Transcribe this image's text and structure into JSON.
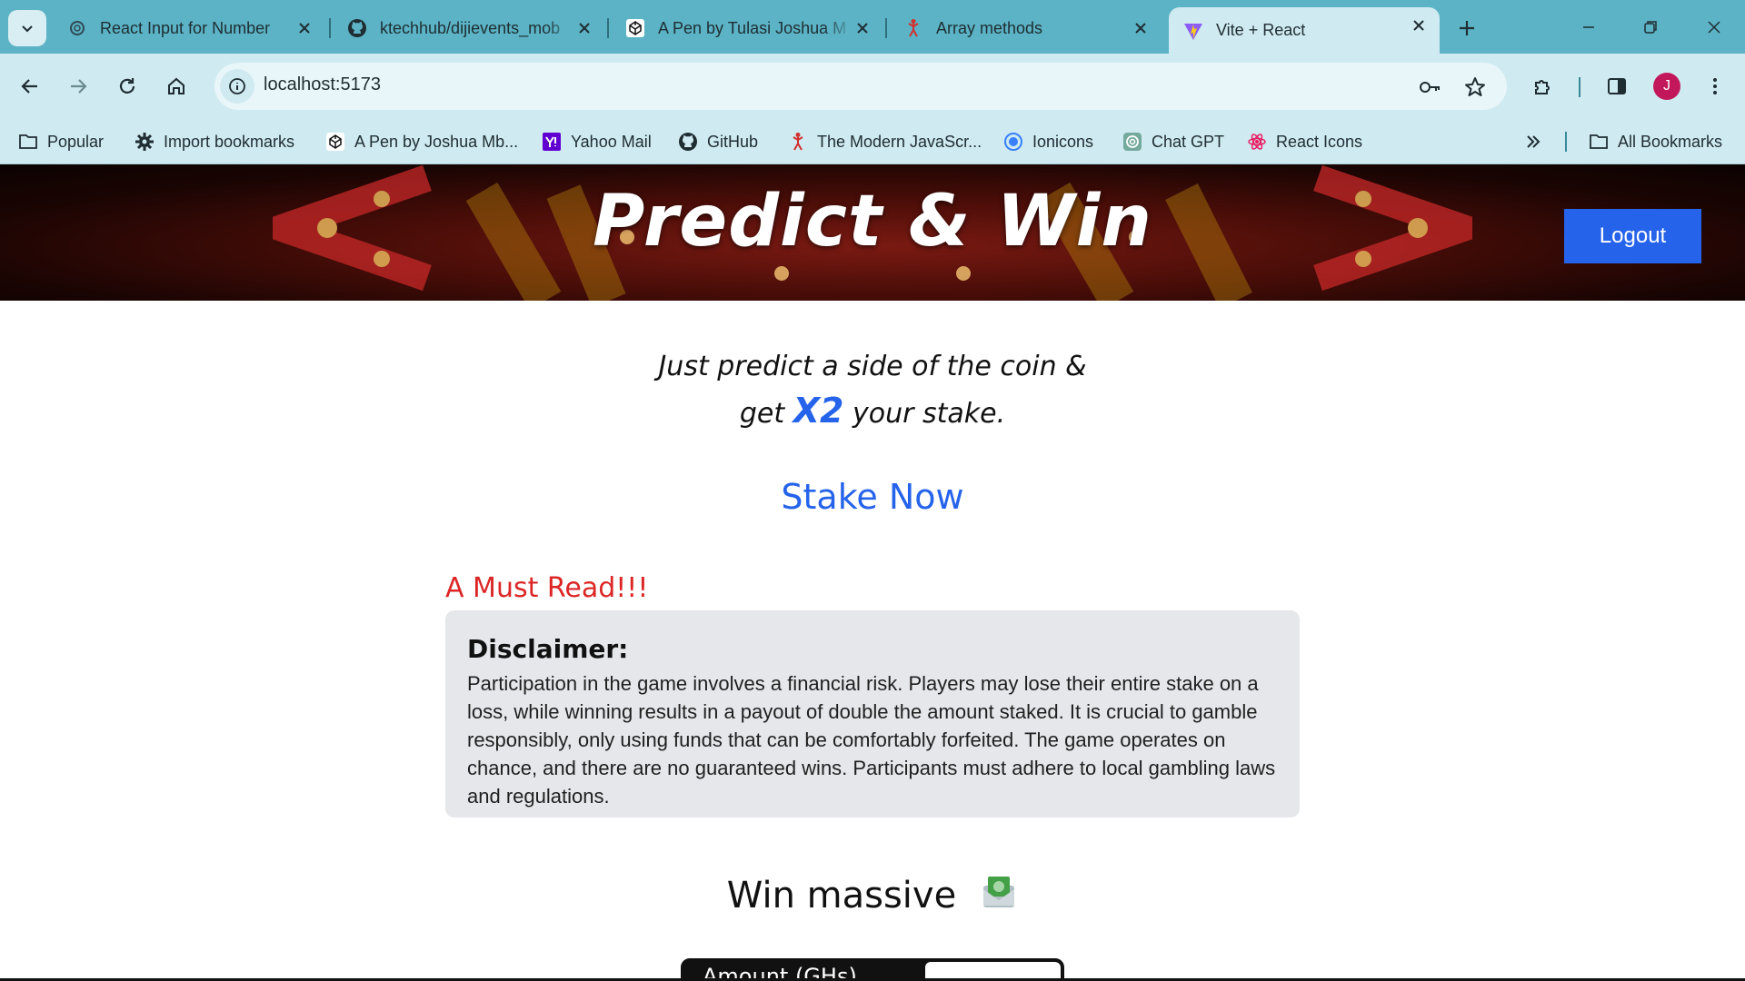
{
  "tabs": [
    {
      "title": "React Input for Number",
      "icon": "openai-icon"
    },
    {
      "title": "ktechhub/dijievents_mob",
      "icon": "github-icon"
    },
    {
      "title": "A Pen by Tulasi Joshua M",
      "icon": "codepen-icon"
    },
    {
      "title": "Array methods",
      "icon": "runner-icon"
    },
    {
      "title": "Vite + React",
      "icon": "vite-icon",
      "active": true
    }
  ],
  "toolbar": {
    "url": "localhost:5173",
    "profile_initial": "J"
  },
  "bookmarks": [
    {
      "label": "Popular",
      "icon": "folder-icon"
    },
    {
      "label": "Import bookmarks",
      "icon": "gear-icon"
    },
    {
      "label": "A Pen by Joshua Mb...",
      "icon": "codepen-icon"
    },
    {
      "label": "Yahoo Mail",
      "icon": "yahoo-icon"
    },
    {
      "label": "GitHub",
      "icon": "github-icon"
    },
    {
      "label": "The Modern JavaScr...",
      "icon": "runner-icon"
    },
    {
      "label": "Ionicons",
      "icon": "ionicons-icon"
    },
    {
      "label": "Chat GPT",
      "icon": "openai-icon"
    },
    {
      "label": "React Icons",
      "icon": "react-icon"
    }
  ],
  "all_bookmarks_label": "All Bookmarks",
  "page": {
    "hero_title": "Predict & Win",
    "logout_label": "Logout",
    "tagline_line1": "Just predict a side of the coin &",
    "tagline_get": "get",
    "tagline_x2": "X2",
    "tagline_rest": "your stake.",
    "stake_now": "Stake Now",
    "must_read": "A Must Read!!!",
    "disclaimer_title": "Disclaimer:",
    "disclaimer_body": "Participation in the game involves a financial risk. Players may lose their entire stake on a loss, while winning results in a payout of double the amount staked. It is crucial to gamble responsibly, only using funds that can be comfortably forfeited. The game operates on chance, and there are no guaranteed wins. Participants must adhere to local gambling laws and regulations.",
    "win_massive": "Win massive",
    "amount_label": "Amount (GHs)"
  },
  "colors": {
    "chrome_tabstrip": "#5bb3c5",
    "chrome_toolbar": "#cfeaf0",
    "accent_blue": "#2563eb",
    "must_read_red": "#dc2626",
    "disclaimer_bg": "#e5e7eb"
  }
}
